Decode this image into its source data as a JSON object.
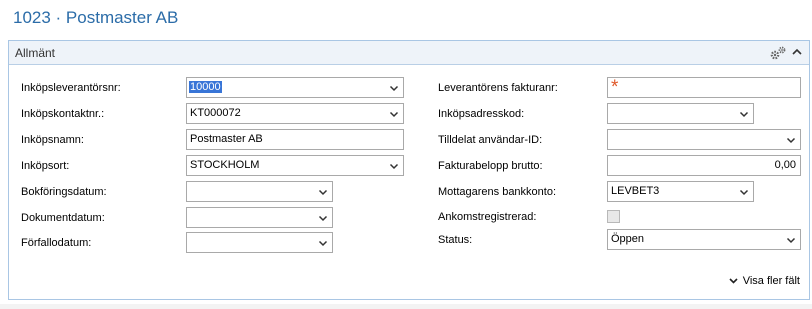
{
  "page": {
    "title": "1023 · Postmaster AB"
  },
  "panel": {
    "title": "Allmänt",
    "show_more_label": "Visa fler fält"
  },
  "left_fields": [
    {
      "label": "Inköpsleverantörsnr:",
      "value": "10000",
      "type": "select"
    },
    {
      "label": "Inköpskontaktnr.:",
      "value": "KT000072",
      "type": "select"
    },
    {
      "label": "Inköpsnamn:",
      "value": "Postmaster AB",
      "type": "text"
    },
    {
      "label": "Inköpsort:",
      "value": "STOCKHOLM",
      "type": "select"
    },
    {
      "label": "Bokföringsdatum:",
      "value": "",
      "type": "select"
    },
    {
      "label": "Dokumentdatum:",
      "value": "",
      "type": "select"
    },
    {
      "label": "Förfallodatum:",
      "value": "",
      "type": "select"
    }
  ],
  "right_fields": [
    {
      "label": "Leverantörens fakturanr:",
      "value": "*",
      "type": "required-text"
    },
    {
      "label": "Inköpsadresskod:",
      "value": "",
      "type": "select"
    },
    {
      "label": "Tilldelat användar-ID:",
      "value": "",
      "type": "select"
    },
    {
      "label": "Fakturabelopp brutto:",
      "value": "0,00",
      "type": "number"
    },
    {
      "label": "Mottagarens bankkonto:",
      "value": "LEVBET3",
      "type": "select"
    },
    {
      "label": "Ankomstregistrerad:",
      "value": false,
      "type": "checkbox"
    },
    {
      "label": "Status:",
      "value": "Öppen",
      "type": "select"
    }
  ],
  "icons": {
    "settings": "gear-icon",
    "collapse": "caret-up-icon",
    "expand_more": "chevron-down-icon"
  },
  "colors": {
    "title": "#2b6ca8",
    "panel_border": "#a9c6e4",
    "panel_header": "#eef3f9",
    "required": "#e05a2b",
    "selection": "#3875d7"
  }
}
